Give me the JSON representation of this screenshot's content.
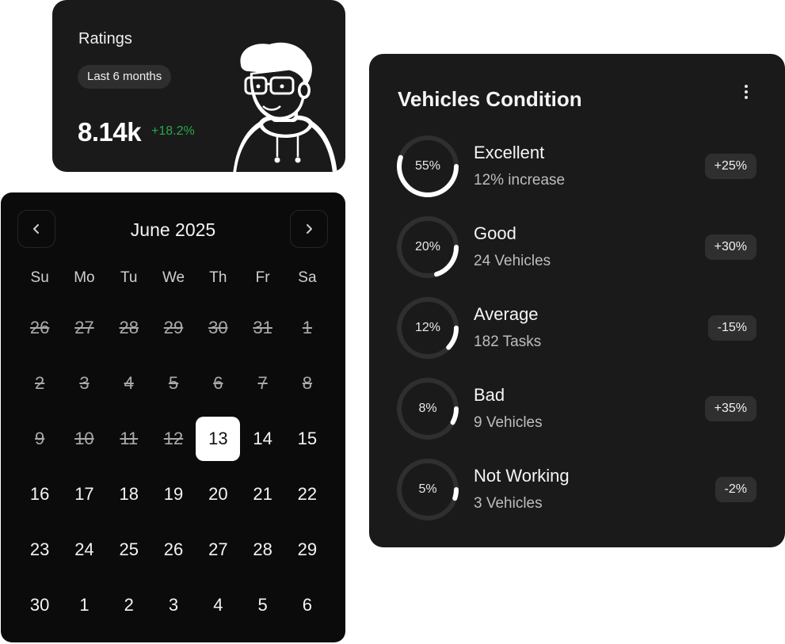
{
  "ratings": {
    "title": "Ratings",
    "period": "Last 6 months",
    "value": "8.14k",
    "change": "+18.2%",
    "accent_color": "#2aa84a"
  },
  "calendar": {
    "title": "June 2025",
    "prev_icon": "chevron-left-icon",
    "next_icon": "chevron-right-icon",
    "weekdays": [
      "Su",
      "Mo",
      "Tu",
      "We",
      "Th",
      "Fr",
      "Sa"
    ],
    "days": [
      {
        "label": "26",
        "state": "past"
      },
      {
        "label": "27",
        "state": "past"
      },
      {
        "label": "28",
        "state": "past"
      },
      {
        "label": "29",
        "state": "past"
      },
      {
        "label": "30",
        "state": "past"
      },
      {
        "label": "31",
        "state": "past"
      },
      {
        "label": "1",
        "state": "past"
      },
      {
        "label": "2",
        "state": "past"
      },
      {
        "label": "3",
        "state": "past"
      },
      {
        "label": "4",
        "state": "past"
      },
      {
        "label": "5",
        "state": "past"
      },
      {
        "label": "6",
        "state": "past"
      },
      {
        "label": "7",
        "state": "past"
      },
      {
        "label": "8",
        "state": "past"
      },
      {
        "label": "9",
        "state": "past"
      },
      {
        "label": "10",
        "state": "past"
      },
      {
        "label": "11",
        "state": "past"
      },
      {
        "label": "12",
        "state": "past"
      },
      {
        "label": "13",
        "state": "selected"
      },
      {
        "label": "14",
        "state": "normal"
      },
      {
        "label": "15",
        "state": "normal"
      },
      {
        "label": "16",
        "state": "normal"
      },
      {
        "label": "17",
        "state": "normal"
      },
      {
        "label": "18",
        "state": "normal"
      },
      {
        "label": "19",
        "state": "normal"
      },
      {
        "label": "20",
        "state": "normal"
      },
      {
        "label": "21",
        "state": "normal"
      },
      {
        "label": "22",
        "state": "normal"
      },
      {
        "label": "23",
        "state": "normal"
      },
      {
        "label": "24",
        "state": "normal"
      },
      {
        "label": "25",
        "state": "normal"
      },
      {
        "label": "26",
        "state": "normal"
      },
      {
        "label": "27",
        "state": "normal"
      },
      {
        "label": "28",
        "state": "normal"
      },
      {
        "label": "29",
        "state": "normal"
      },
      {
        "label": "30",
        "state": "normal"
      },
      {
        "label": "1",
        "state": "normal"
      },
      {
        "label": "2",
        "state": "normal"
      },
      {
        "label": "3",
        "state": "normal"
      },
      {
        "label": "4",
        "state": "normal"
      },
      {
        "label": "5",
        "state": "normal"
      },
      {
        "label": "6",
        "state": "normal"
      }
    ]
  },
  "vehicles": {
    "title": "Vehicles Condition",
    "menu_icon": "more-vertical-icon",
    "items": [
      {
        "percent_label": "55%",
        "percent": 55,
        "name": "Excellent",
        "sub": "12% increase",
        "badge": "+25%"
      },
      {
        "percent_label": "20%",
        "percent": 20,
        "name": "Good",
        "sub": "24 Vehicles",
        "badge": "+30%"
      },
      {
        "percent_label": "12%",
        "percent": 12,
        "name": "Average",
        "sub": "182 Tasks",
        "badge": "-15%"
      },
      {
        "percent_label": "8%",
        "percent": 8,
        "name": "Bad",
        "sub": "9 Vehicles",
        "badge": "+35%"
      },
      {
        "percent_label": "5%",
        "percent": 5,
        "name": "Not Working",
        "sub": "3 Vehicles",
        "badge": "-2%"
      }
    ]
  }
}
